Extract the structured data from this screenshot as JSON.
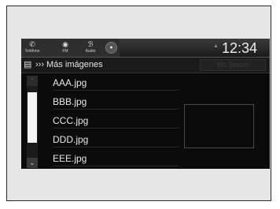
{
  "status_bar": {
    "phone_label": "Teléfono",
    "fm_label": "FM",
    "audio_label": "Audio",
    "clock": "12:34"
  },
  "header": {
    "title": "Más imágenes",
    "right_button": "Mc 3ssoci"
  },
  "files": [
    "AAA.jpg",
    "BBB.jpg",
    "CCC.jpg",
    "DDD.jpg",
    "EEE.jpg"
  ]
}
